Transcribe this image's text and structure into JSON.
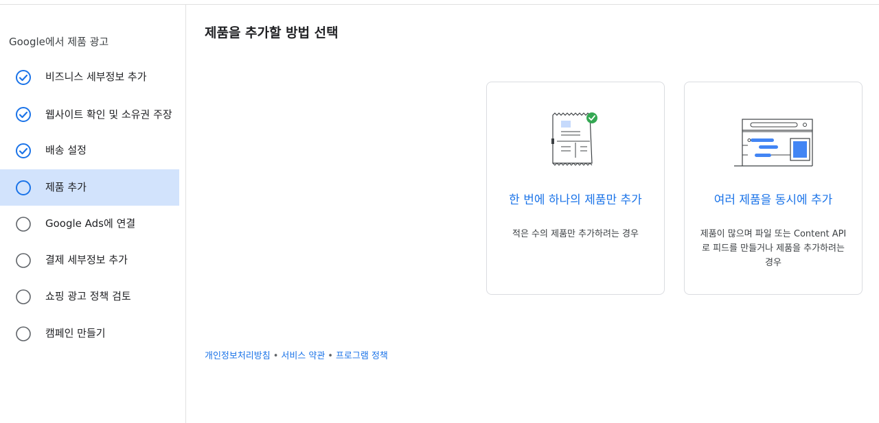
{
  "sidebar": {
    "title": "Google에서 제품 광고",
    "steps": [
      {
        "label": "비즈니스 세부정보 추가",
        "status": "done"
      },
      {
        "label": "웹사이트 확인 및 소유권 주장",
        "status": "done"
      },
      {
        "label": "배송 설정",
        "status": "done"
      },
      {
        "label": "제품 추가",
        "status": "current"
      },
      {
        "label": "Google Ads에 연결",
        "status": "todo"
      },
      {
        "label": "결제 세부정보 추가",
        "status": "todo"
      },
      {
        "label": "쇼핑 광고 정책 검토",
        "status": "todo"
      },
      {
        "label": "캠페인 만들기",
        "status": "todo"
      }
    ]
  },
  "main": {
    "title": "제품을 추가할 방법 선택",
    "cards": [
      {
        "title": "한 번에 하나의 제품만 추가",
        "description": "적은 수의 제품만 추가하려는 경우",
        "icon": "single-product-receipt-icon"
      },
      {
        "title": "여러 제품을 동시에 추가",
        "description": "제품이 많으며 파일 또는 Content API로 피드를 만들거나 제품을 추가하려는 경우",
        "icon": "multiple-products-feed-icon"
      }
    ]
  },
  "footer": {
    "links": [
      "개인정보처리방침",
      "서비스 약관",
      "프로그램 정책"
    ],
    "separator": "•"
  },
  "colors": {
    "accent": "#1a73e8",
    "active_bg": "#d2e3fc",
    "check_green": "#34a853",
    "todo_circle": "#5f6368"
  }
}
